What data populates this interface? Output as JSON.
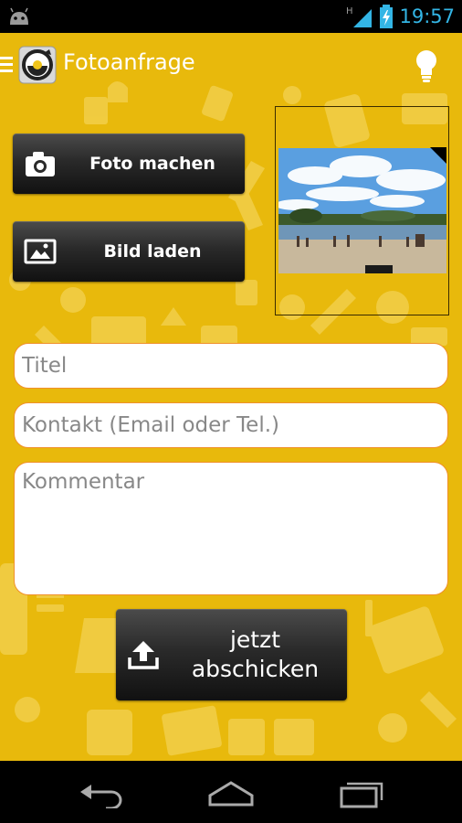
{
  "status_bar": {
    "time": "19:57",
    "network_label": "H",
    "icons": [
      "android-icon",
      "signal-icon",
      "battery-charging-icon"
    ]
  },
  "app": {
    "title": "Fotoanfrage",
    "icons": [
      "menu-icon",
      "app-logo-icon",
      "lightbulb-icon"
    ]
  },
  "buttons": {
    "take_photo": "Foto machen",
    "load_image": "Bild laden",
    "send_line1": "jetzt",
    "send_line2": "abschicken"
  },
  "form": {
    "title_placeholder": "Titel",
    "contact_placeholder": "Kontakt (Email oder Tel.)",
    "comment_placeholder": "Kommentar"
  },
  "nav": [
    "back-icon",
    "home-icon",
    "recent-apps-icon"
  ],
  "colors": {
    "background": "#e8b90c",
    "accent": "#33b5e5",
    "field_border": "#f0902a"
  }
}
